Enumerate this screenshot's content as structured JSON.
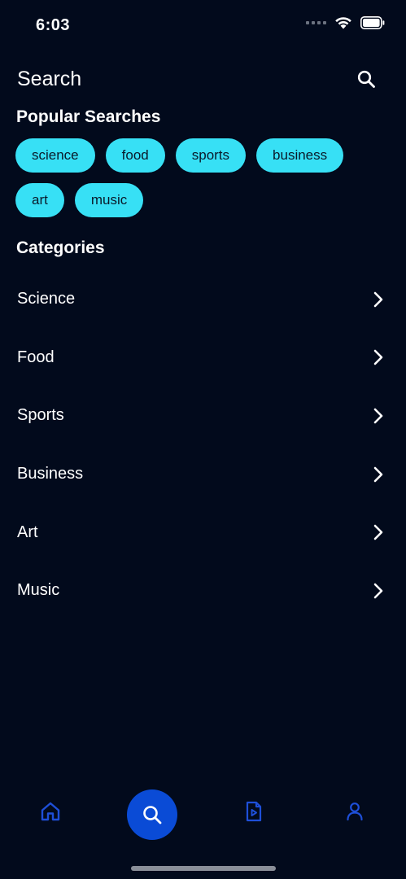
{
  "status_bar": {
    "time": "6:03"
  },
  "header": {
    "title": "Search",
    "search_icon": "search-icon"
  },
  "popular": {
    "title": "Popular Searches",
    "chips": [
      "science",
      "food",
      "sports",
      "business",
      "art",
      "music"
    ]
  },
  "categories": {
    "title": "Categories",
    "items": [
      "Science",
      "Food",
      "Sports",
      "Business",
      "Art",
      "Music"
    ]
  },
  "bottom_nav": {
    "items": [
      {
        "name": "home",
        "icon": "home-icon",
        "active": false
      },
      {
        "name": "search",
        "icon": "search-icon",
        "active": true
      },
      {
        "name": "media",
        "icon": "video-file-icon",
        "active": false
      },
      {
        "name": "profile",
        "icon": "user-icon",
        "active": false
      }
    ]
  },
  "colors": {
    "background": "#020a1c",
    "chip": "#37e0f5",
    "accent": "#0a4bd6",
    "nav_icon": "#1e4fd8"
  }
}
